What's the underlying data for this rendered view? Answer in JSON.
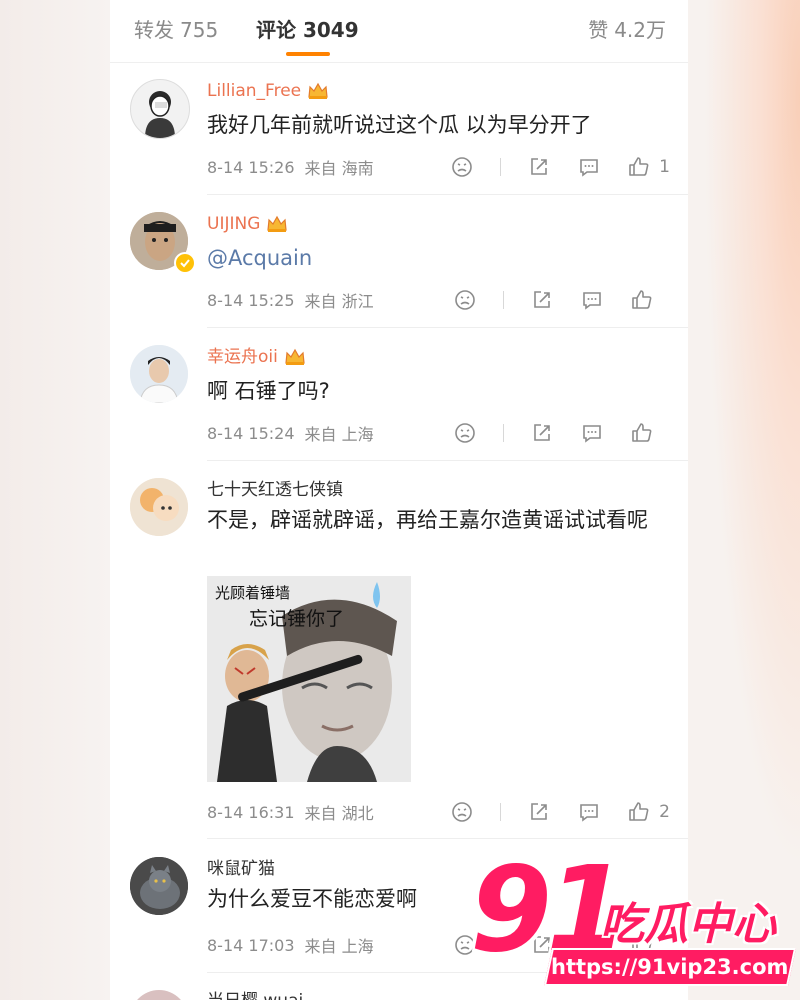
{
  "tabs": {
    "repost_label": "转发",
    "repost_count": "755",
    "comment_label": "评论",
    "comment_count": "3049",
    "likes_label": "赞",
    "likes_count": "4.2万"
  },
  "colors": {
    "accent": "#ff8200",
    "vip_name": "#eb7350",
    "mention": "#5b7aa8",
    "watermark": "#ff1c62"
  },
  "comments": [
    {
      "user": "Lillian_Free",
      "vip": true,
      "text": "我好几年前就听说过这个瓜 以为早分开了",
      "time": "8-14 15:26",
      "source": "来自 海南",
      "likes": "1"
    },
    {
      "user": "UIJING",
      "vip": true,
      "mention": "@Acquain",
      "time": "8-14 15:25",
      "source": "来自 浙江",
      "likes": ""
    },
    {
      "user": "幸运舟oii",
      "vip": true,
      "text": "啊 石锤了吗?",
      "time": "8-14 15:24",
      "source": "来自 上海",
      "likes": ""
    },
    {
      "user": "七十天红透七侠镇",
      "vip": false,
      "text": "不是，辟谣就辟谣，再给王嘉尔造黄谣试试看呢",
      "time": "8-14 16:31",
      "source": "来自 湖北",
      "likes": "2",
      "meme": {
        "line1": "光顾着锤墙",
        "line2": "忘记锤你了"
      }
    },
    {
      "user": "咪鼠矿猫",
      "vip": false,
      "text": "为什么爱豆不能恋爱啊",
      "time": "8-14 17:03",
      "source": "来自 上海",
      "likes": ""
    }
  ],
  "partial_user": "当日樱 wuai",
  "watermark": {
    "number": "91",
    "text": "吃瓜中心",
    "url": "https://91vip23.com"
  },
  "icons": [
    "dislike-icon",
    "share-icon",
    "comment-icon",
    "like-icon",
    "crown-icon",
    "verified-icon"
  ]
}
